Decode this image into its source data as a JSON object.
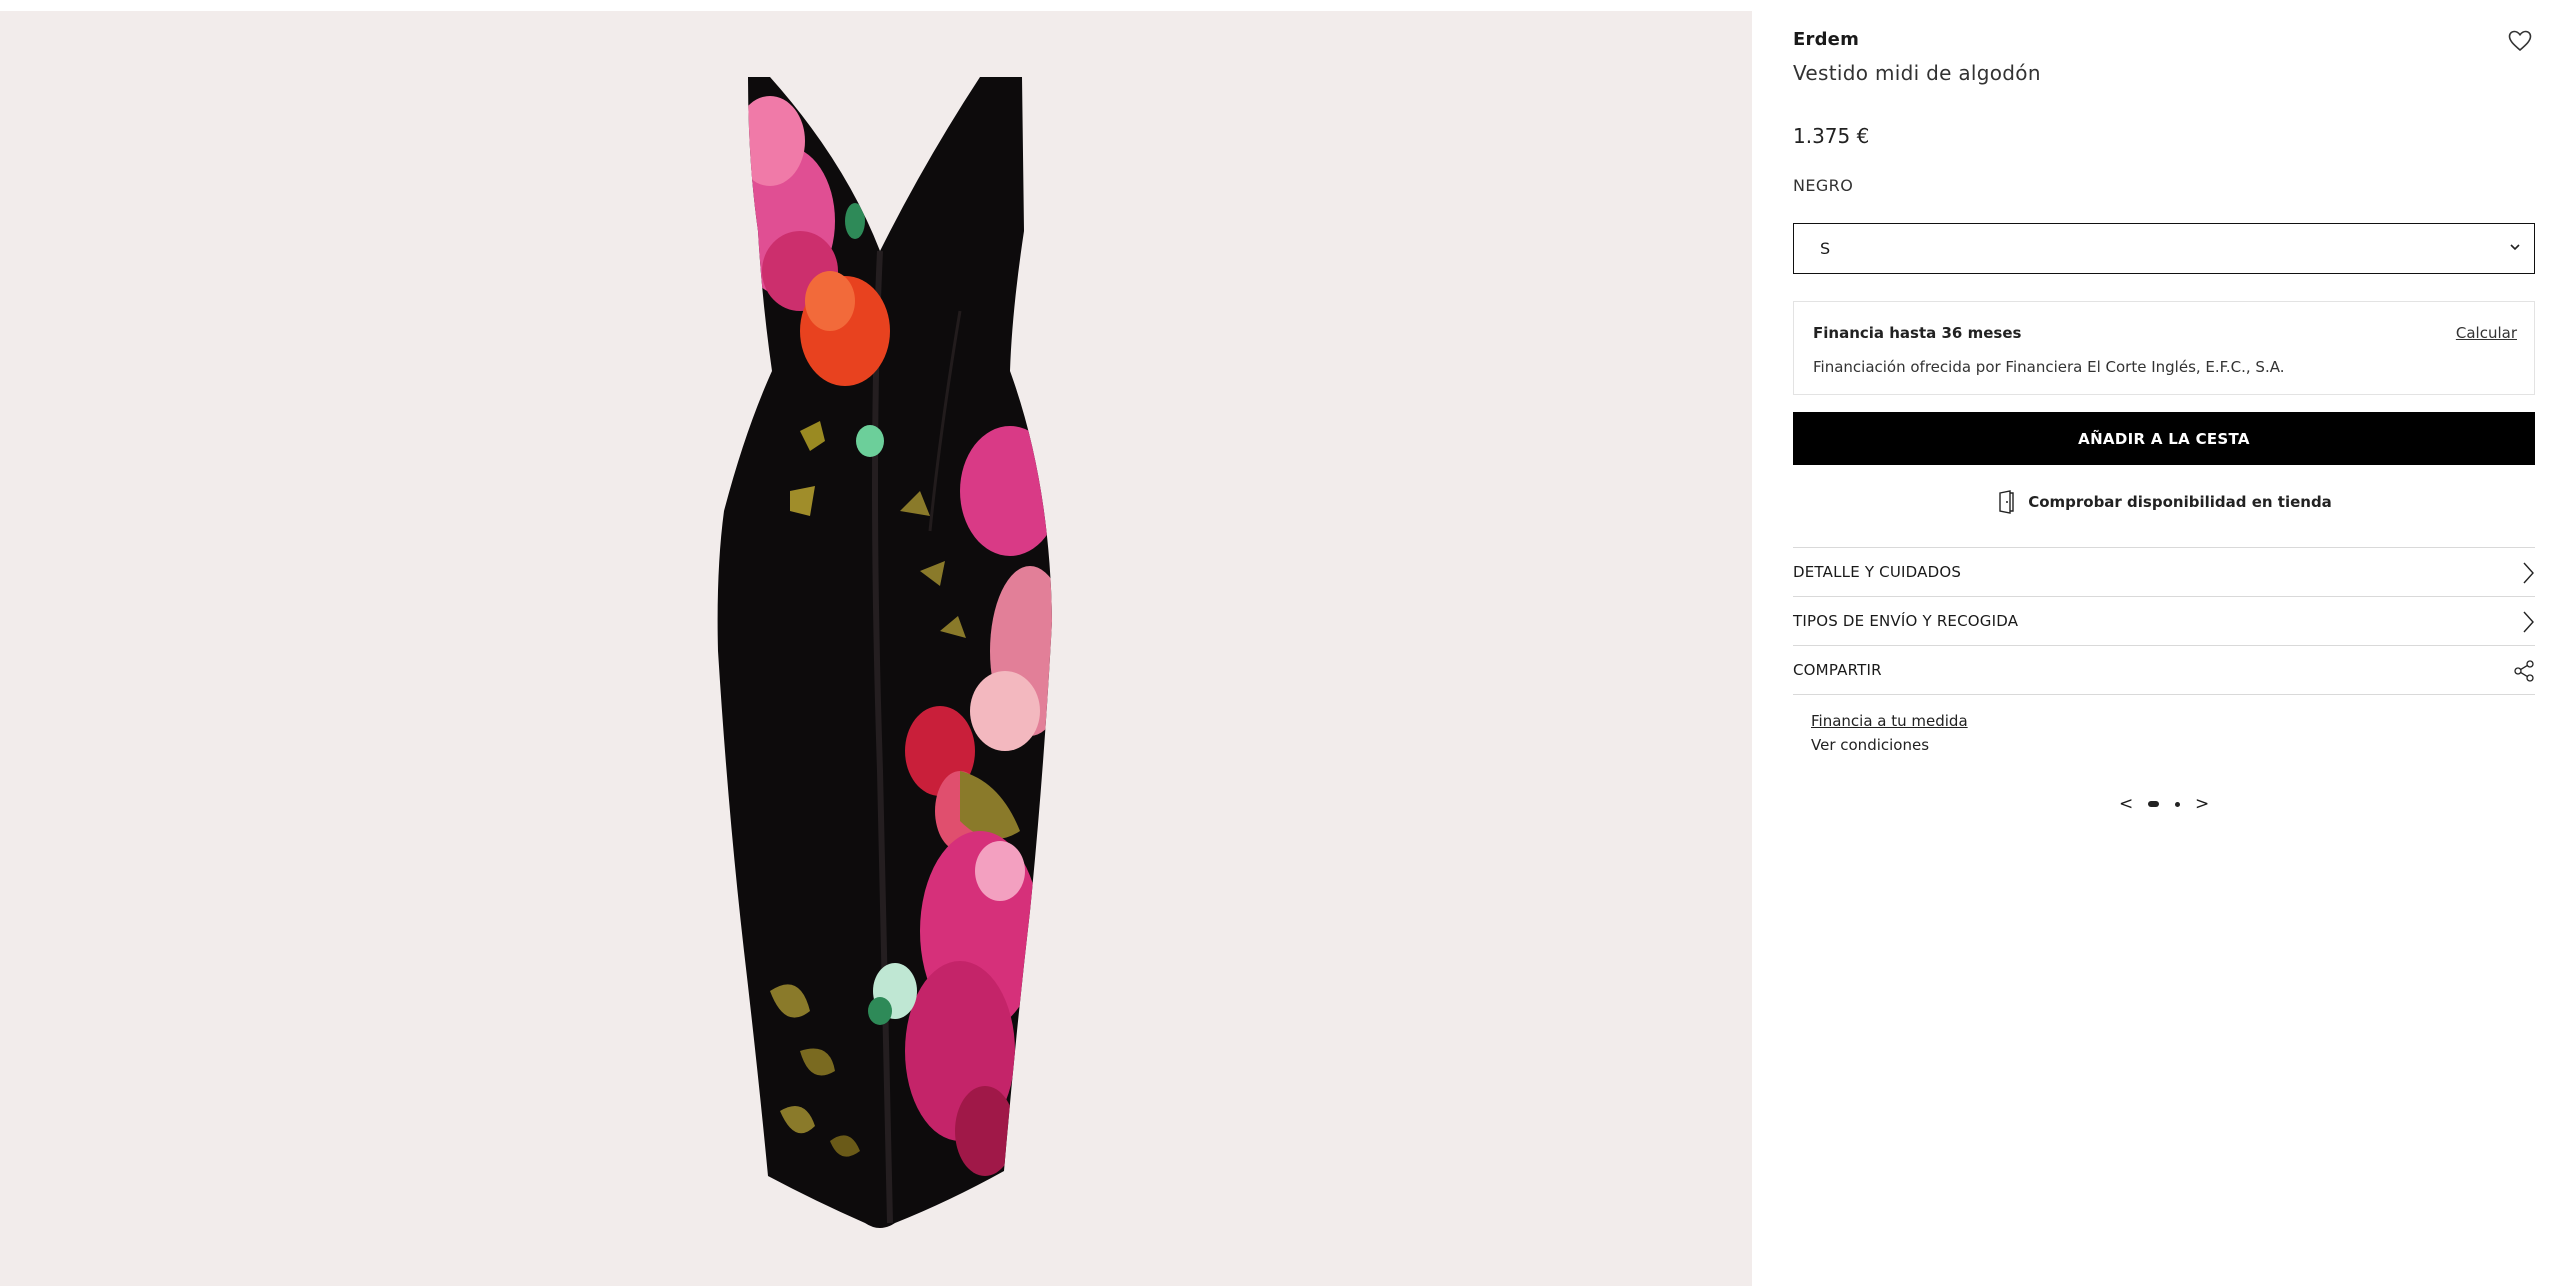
{
  "product": {
    "brand": "Erdem",
    "name": "Vestido midi de algodón",
    "price": "1.375 €",
    "color": "NEGRO",
    "size_selected": "S"
  },
  "finance": {
    "title": "Financia hasta 36 meses",
    "calculate_label": "Calcular",
    "subtitle": "Financiación ofrecida por Financiera El Corte Inglés, E.F.C., S.A."
  },
  "actions": {
    "add_to_cart": "AÑADIR A LA CESTA",
    "check_store": "Comprobar disponibilidad en tienda"
  },
  "accordion": [
    {
      "label": "DETALLE Y CUIDADOS",
      "icon": "chevron-right-icon"
    },
    {
      "label": "TIPOS DE ENVÍO Y RECOGIDA",
      "icon": "chevron-right-icon"
    },
    {
      "label": "COMPARTIR",
      "icon": "share-icon"
    }
  ],
  "promo": {
    "link": "Financia a tu medida",
    "sub": "Ver condiciones"
  },
  "carousel": {
    "prev": "<",
    "next": ">"
  },
  "colors": {
    "gallery_bg": "#f2eceb",
    "dress_black": "#0d0b0c",
    "floral_pink": "#d93a86",
    "floral_red": "#e4472a",
    "floral_olive": "#8a7a2a",
    "button_bg": "#000000"
  }
}
